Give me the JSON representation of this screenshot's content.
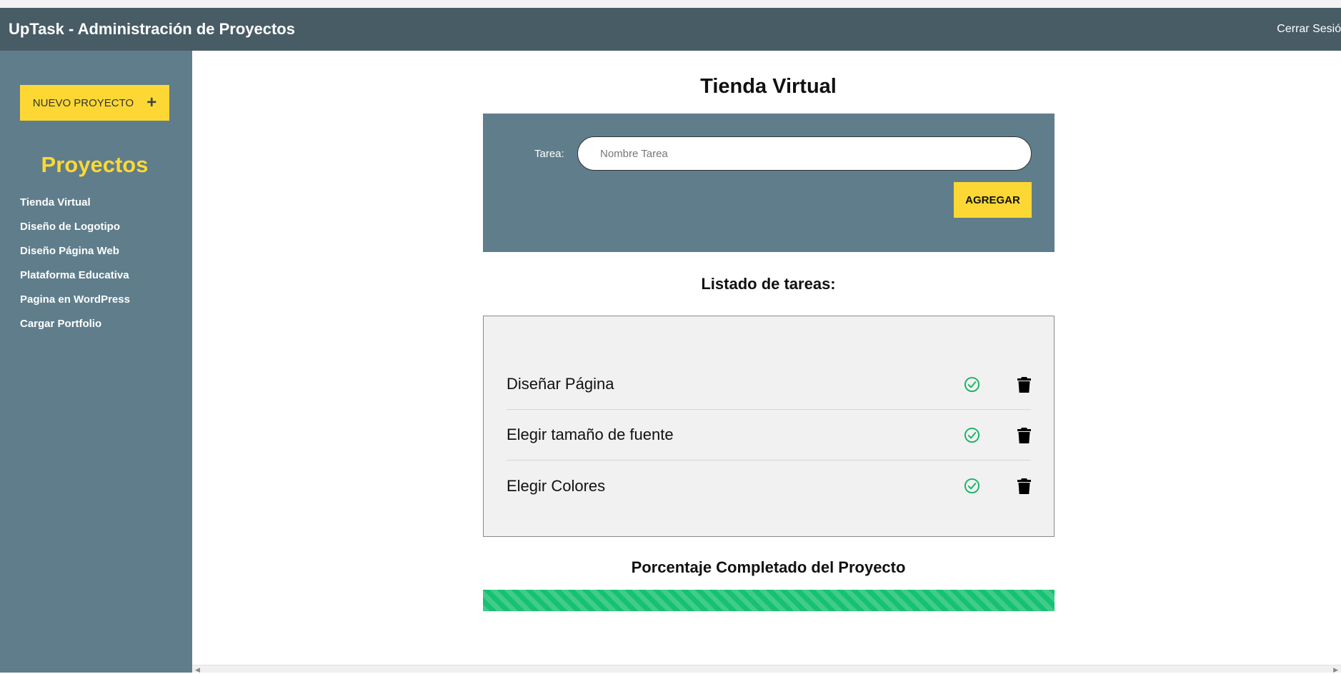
{
  "header": {
    "title": "UpTask - Administración de Proyectos",
    "logout_label": "Cerrar Sesión"
  },
  "sidebar": {
    "new_project_label": "NUEVO PROYECTO",
    "new_project_icon": "plus-icon",
    "heading": "Proyectos",
    "projects": [
      "Tienda Virtual",
      "Diseño de Logotipo",
      "Diseño Página Web",
      "Plataforma Educativa",
      "Pagina en WordPress",
      "Cargar Portfolio"
    ]
  },
  "main": {
    "project_title": "Tienda Virtual",
    "form": {
      "task_label": "Tarea:",
      "task_placeholder": "Nombre Tarea",
      "task_value": "",
      "add_label": "AGREGAR"
    },
    "list_heading": "Listado de tareas:",
    "tasks": [
      {
        "name": "Diseñar Página",
        "complete_icon": "check-circle-icon",
        "delete_icon": "trash-icon"
      },
      {
        "name": "Elegir tamaño de fuente",
        "complete_icon": "check-circle-icon",
        "delete_icon": "trash-icon"
      },
      {
        "name": "Elegir Colores",
        "complete_icon": "check-circle-icon",
        "delete_icon": "trash-icon"
      }
    ],
    "progress": {
      "heading": "Porcentaje Completado del Proyecto",
      "percent": 100
    }
  },
  "colors": {
    "header": "#485c66",
    "sidebar": "#607d8b",
    "accent_yellow": "#fdd835",
    "check_green": "#16b364",
    "progress_green": "#16c172",
    "task_panel_bg": "#f1f1f1"
  }
}
